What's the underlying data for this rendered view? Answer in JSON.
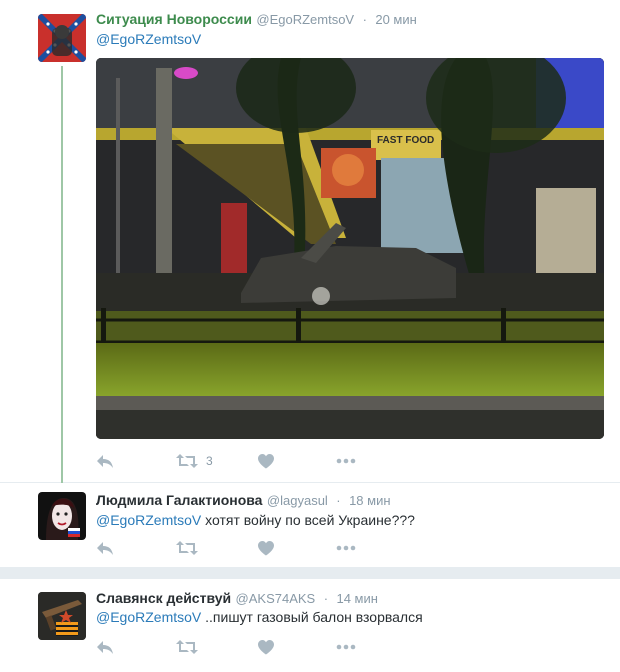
{
  "tweets": [
    {
      "name": "Ситуация Новороссии",
      "handle": "@EgoRZemtsoV",
      "time": "20 мин",
      "mention": "@EgoRZemtsoV",
      "text": "",
      "retweet_count": "3"
    },
    {
      "name": "Людмила Галактионова",
      "handle": "@lagyasul",
      "time": "18 мин",
      "mention": "@EgoRZemtsoV",
      "text": " хотят войну по всей Украине???",
      "retweet_count": ""
    },
    {
      "name": "Славянск действуй",
      "handle": "@AKS74AKS",
      "time": "14 мин",
      "mention": "@EgoRZemtsoV",
      "text": " ..пишут газовый балон взорвался",
      "retweet_count": ""
    }
  ],
  "photo": {
    "sign_text": "FAST FOOD"
  },
  "separator": "·",
  "colors": {
    "name_green": "#3d8b4d",
    "mention_blue": "#2b7bb9",
    "icon_gray": "#aab8c2",
    "thread_line": "#9ec7a6"
  },
  "icons": [
    "reply-icon",
    "retweet-icon",
    "like-icon",
    "more-icon"
  ]
}
